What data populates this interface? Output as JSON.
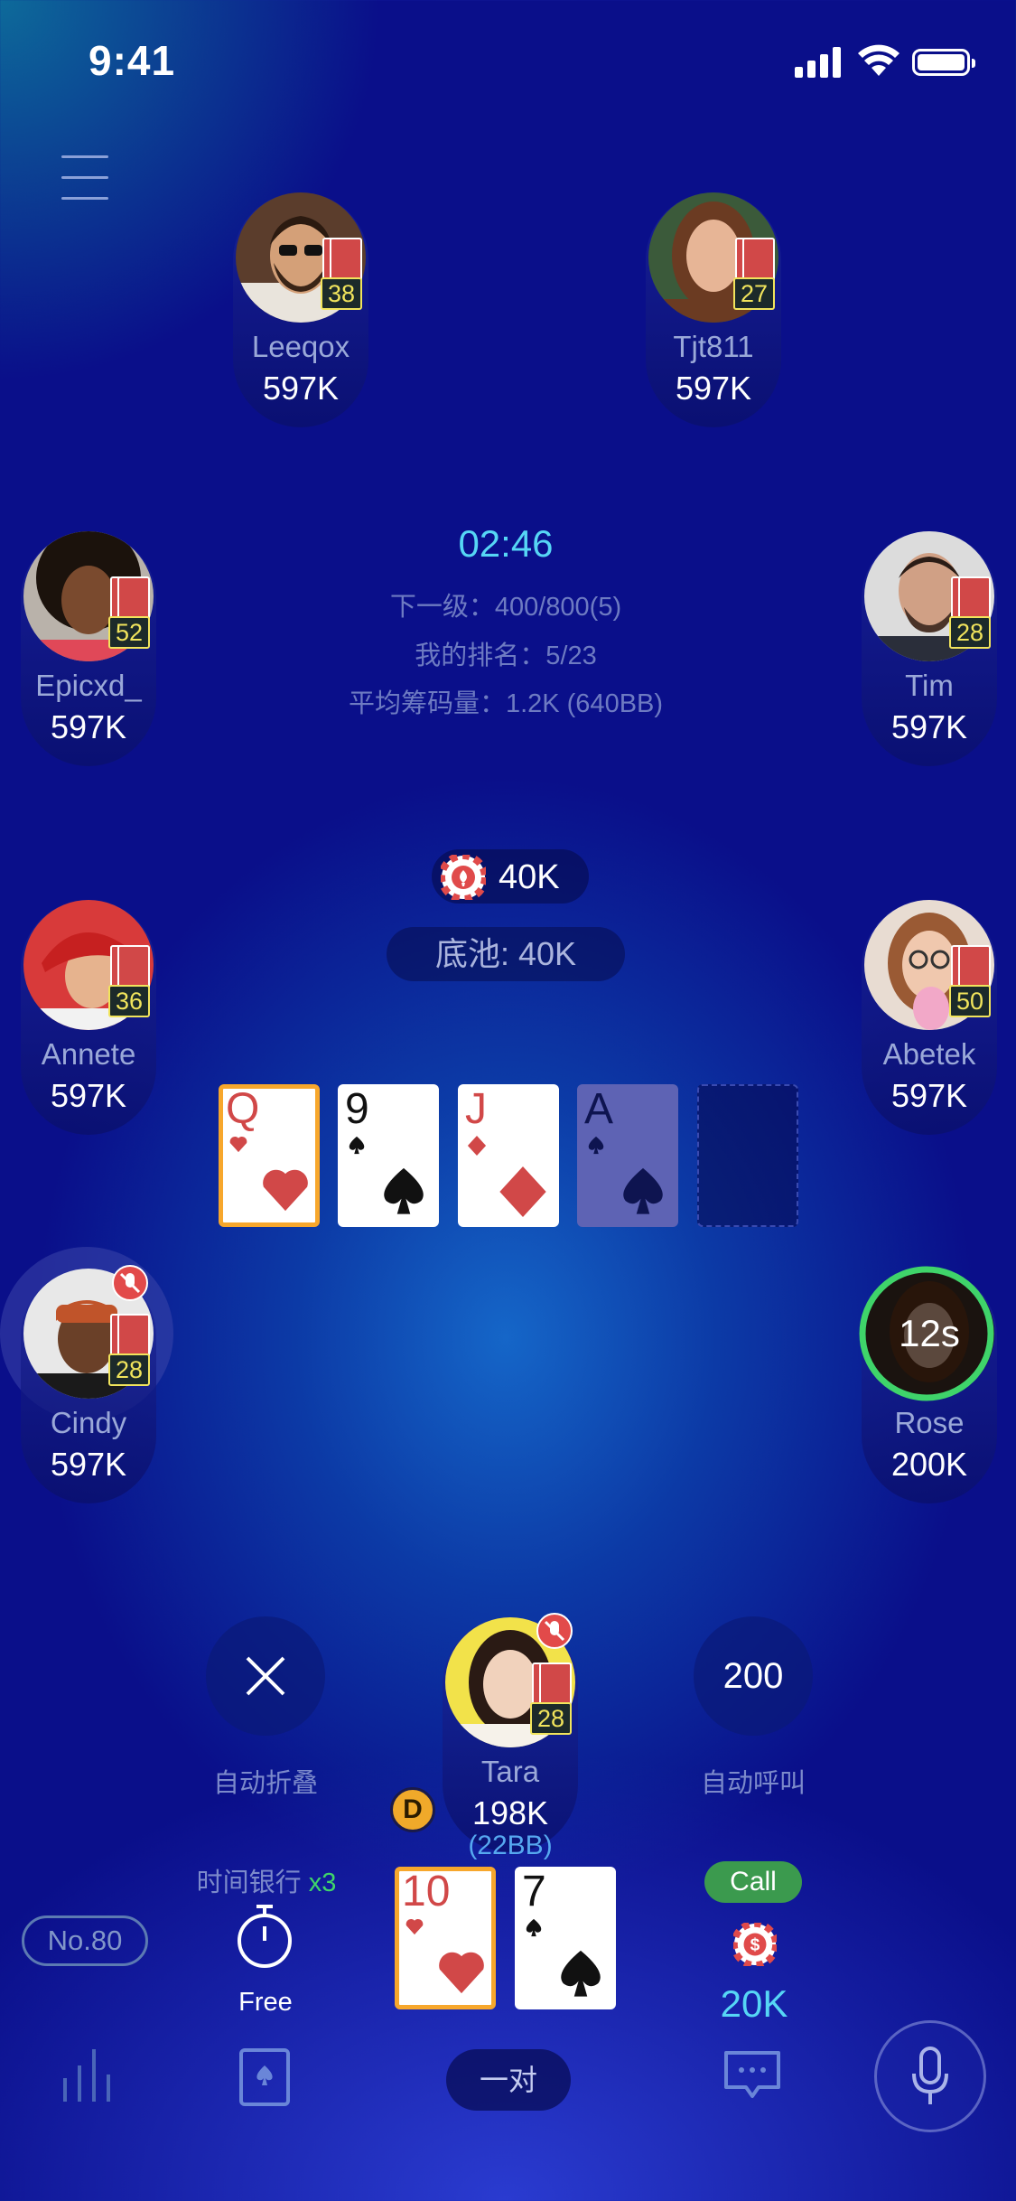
{
  "status_bar": {
    "time": "9:41"
  },
  "players": {
    "leeqox": {
      "name": "Leeqox",
      "chips": "597K",
      "cards": "38"
    },
    "tjt811": {
      "name": "Tjt811",
      "chips": "597K",
      "cards": "27"
    },
    "epicxd": {
      "name": "Epicxd_",
      "chips": "597K",
      "cards": "52"
    },
    "tim": {
      "name": "Tim",
      "chips": "597K",
      "cards": "28"
    },
    "annete": {
      "name": "Annete",
      "chips": "597K",
      "cards": "36"
    },
    "abetek": {
      "name": "Abetek",
      "chips": "597K",
      "cards": "50"
    },
    "cindy": {
      "name": "Cindy",
      "chips": "597K",
      "cards": "28"
    },
    "rose": {
      "name": "Rose",
      "chips": "200K",
      "timer": "12s"
    },
    "tara": {
      "name": "Tara",
      "chips": "198K",
      "cards": "28",
      "bb": "(22BB)"
    }
  },
  "tournament": {
    "clock": "02:46",
    "next_level": "下一级：400/800(5)",
    "my_rank": "我的排名：5/23",
    "avg_stack": "平均筹码量：1.2K (640BB)"
  },
  "pot": {
    "bet": "40K",
    "total": "底池: 40K"
  },
  "board": [
    {
      "rank": "Q",
      "suit": "heart"
    },
    {
      "rank": "9",
      "suit": "spade"
    },
    {
      "rank": "J",
      "suit": "diamond"
    },
    {
      "rank": "A",
      "suit": "spade"
    }
  ],
  "hole_cards": [
    {
      "rank": "10",
      "suit": "heart"
    },
    {
      "rank": "7",
      "suit": "spade"
    }
  ],
  "controls": {
    "auto_fold": "自动折叠",
    "auto_call_amount": "200",
    "auto_call": "自动呼叫",
    "time_bank": "时间银行",
    "time_bank_mult": "x3",
    "free": "Free",
    "dealer": "D",
    "call": "Call",
    "call_amount": "20K",
    "hand_rank": "一对",
    "table_no": "No.80"
  },
  "colors": {
    "timer": "#56d6f5",
    "call_green": "#3b9a4e",
    "selected_card": "#f7a72c",
    "red_suit": "#d14848"
  }
}
